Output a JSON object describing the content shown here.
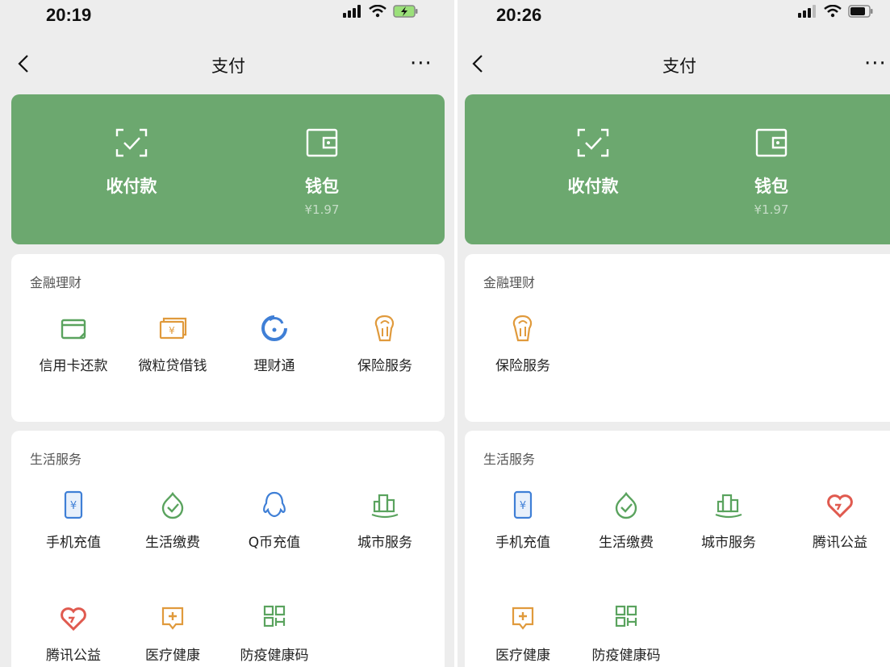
{
  "left": {
    "status_time": "20:19",
    "nav": {
      "title": "支付",
      "back_glyph": "〈",
      "more_glyph": "···"
    },
    "card": {
      "pay_label": "收付款",
      "wallet_label": "钱包",
      "wallet_balance": "¥1.97"
    },
    "finance": {
      "title": "金融理财",
      "items": [
        {
          "label": "信用卡还款",
          "icon": "credit-card-icon"
        },
        {
          "label": "微粒贷借钱",
          "icon": "loan-icon"
        },
        {
          "label": "理财通",
          "icon": "wealth-icon"
        },
        {
          "label": "保险服务",
          "icon": "insurance-icon"
        }
      ]
    },
    "life": {
      "title": "生活服务",
      "items": [
        {
          "label": "手机充值",
          "icon": "phone-recharge-icon"
        },
        {
          "label": "生活缴费",
          "icon": "utility-icon"
        },
        {
          "label": "Q币充值",
          "icon": "qq-icon"
        },
        {
          "label": "城市服务",
          "icon": "city-icon"
        },
        {
          "label": "腾讯公益",
          "icon": "charity-heart-icon"
        },
        {
          "label": "医疗健康",
          "icon": "medical-icon"
        },
        {
          "label": "防疫健康码",
          "icon": "qr-code-icon"
        }
      ]
    }
  },
  "right": {
    "status_time": "20:26",
    "nav": {
      "title": "支付",
      "back_glyph": "〈",
      "more_glyph": "···"
    },
    "card": {
      "pay_label": "收付款",
      "wallet_label": "钱包",
      "wallet_balance": "¥1.97"
    },
    "finance": {
      "title": "金融理财",
      "items": [
        {
          "label": "保险服务",
          "icon": "insurance-icon"
        }
      ]
    },
    "life": {
      "title": "生活服务",
      "items": [
        {
          "label": "手机充值",
          "icon": "phone-recharge-icon"
        },
        {
          "label": "生活缴费",
          "icon": "utility-icon"
        },
        {
          "label": "城市服务",
          "icon": "city-icon"
        },
        {
          "label": "腾讯公益",
          "icon": "charity-heart-icon"
        },
        {
          "label": "医疗健康",
          "icon": "medical-icon"
        },
        {
          "label": "防疫健康码",
          "icon": "qr-code-icon"
        }
      ]
    }
  },
  "colors": {
    "card_green": "#6ca86f",
    "icon_green": "#5aa35e",
    "icon_blue": "#3f7fd6",
    "icon_orange": "#e09a3c",
    "icon_red": "#e05a4f",
    "background": "#ededed"
  }
}
